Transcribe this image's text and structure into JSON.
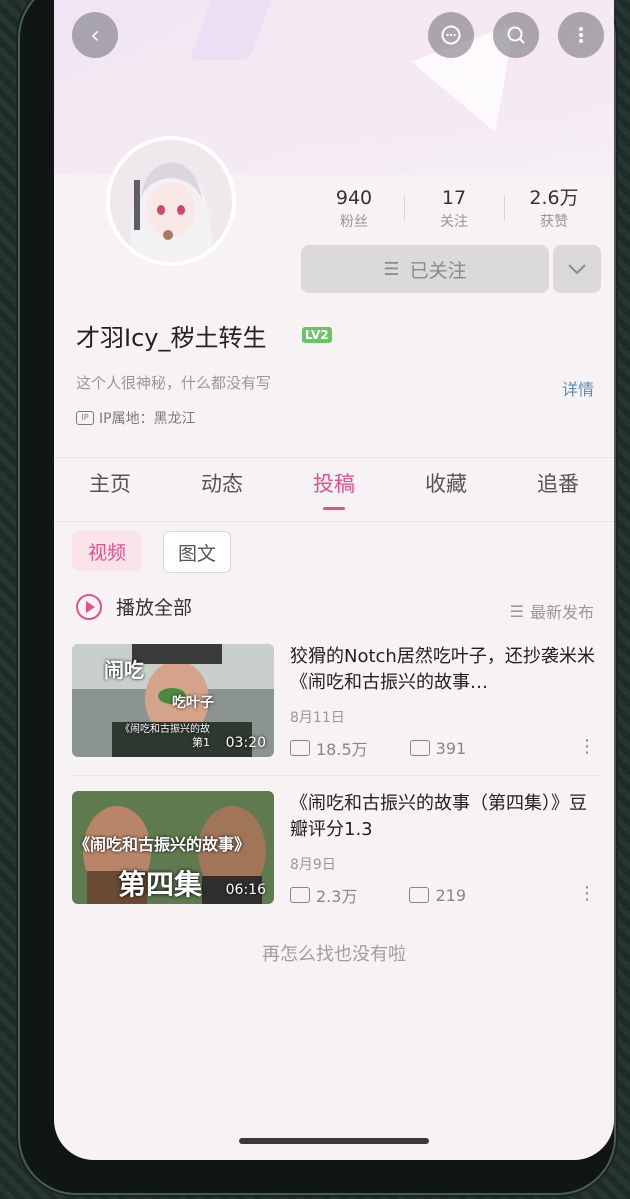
{
  "profile": {
    "followers_count": "940",
    "followers_label": "粉丝",
    "following_count": "17",
    "following_label": "关注",
    "likes_count": "2.6万",
    "likes_label": "获赞",
    "follow_status": "已关注",
    "username": "才羽Icy_秽土转生",
    "level": "LV2",
    "bio": "这个人很神秘，什么都没有写",
    "detail_label": "详情",
    "ip_location": "IP属地：黑龙江"
  },
  "tabs": [
    {
      "label": "主页"
    },
    {
      "label": "动态"
    },
    {
      "label": "投稿"
    },
    {
      "label": "收藏"
    },
    {
      "label": "追番"
    }
  ],
  "filters": {
    "video": "视频",
    "image_text": "图文"
  },
  "list_header": {
    "play_all": "播放全部",
    "sort": "最新发布"
  },
  "videos": [
    {
      "title": "狡猾的Notch居然吃叶子，还抄袭米米《闹吃和古振兴的故事…",
      "date": "8月11日",
      "views": "18.5万",
      "comments": "391",
      "duration": "03:20",
      "thumb_text_1": "闹吃",
      "thumb_text_2": "吃叶子",
      "thumb_text_3": "《闹吃和古振兴的故",
      "thumb_text_4": "第1"
    },
    {
      "title": "《闹吃和古振兴的故事（第四集）》豆瓣评分1.3",
      "date": "8月9日",
      "views": "2.3万",
      "comments": "219",
      "duration": "06:16",
      "thumb_text_1": "《闹吃和古振兴的故事》",
      "thumb_text_2": "第四集"
    }
  ],
  "empty_message": "再怎么找也没有啦",
  "colors": {
    "accent": "#e1528a",
    "link": "#5b8ab5",
    "level": "#6cc36a"
  }
}
